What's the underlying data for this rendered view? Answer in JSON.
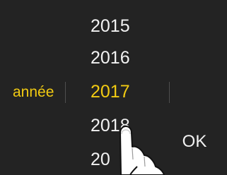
{
  "picker": {
    "field_label": "année",
    "years": [
      "2015",
      "2016",
      "2017",
      "2018",
      "20"
    ],
    "selected_year": "2017"
  },
  "actions": {
    "ok_label": "OK"
  },
  "colors": {
    "background": "#232323",
    "text": "#f2f2f2",
    "accent": "#f2cb12"
  },
  "icons": {
    "pointer": "tap-hand-icon"
  }
}
